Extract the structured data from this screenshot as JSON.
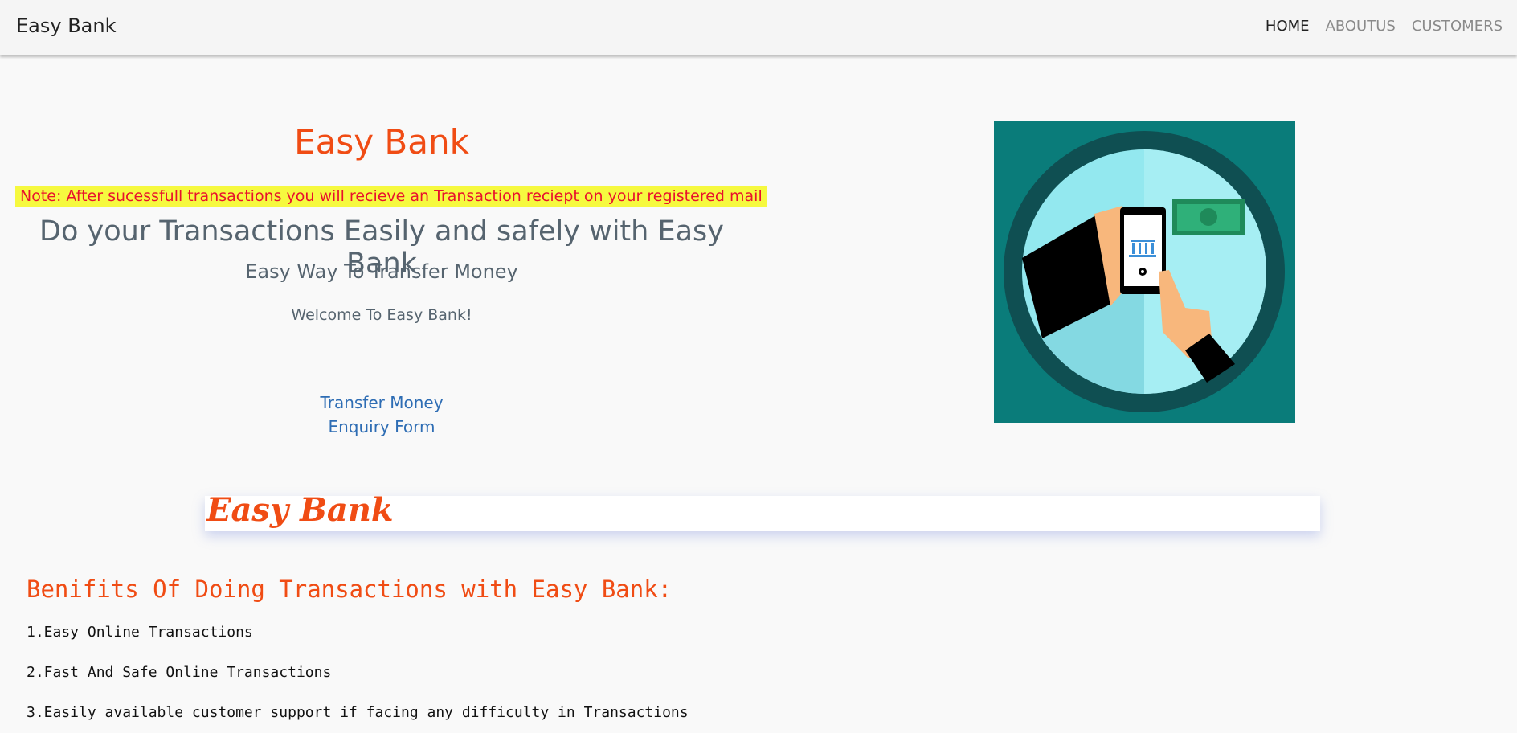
{
  "navbar": {
    "brand": "Easy Bank",
    "links": [
      {
        "label": "HOME",
        "active": true
      },
      {
        "label": "ABOUTUS",
        "active": false
      },
      {
        "label": "CUSTOMERS",
        "active": false
      }
    ]
  },
  "hero": {
    "title": "Easy Bank",
    "note": "Note: After sucessfull transactions you will recieve an Transaction reciept on your registered mail",
    "tagline": "Do your Transactions Easily and safely with Easy Bank",
    "subtitle": "Easy Way To Transfer Money",
    "welcome": "Welcome To Easy Bank!",
    "links": [
      "Transfer Money",
      "Enquiry Form"
    ]
  },
  "banner": {
    "text": "Easy Bank"
  },
  "benefits": {
    "title": "Benifits Of Doing Transactions with Easy Bank:",
    "items": [
      "1.Easy Online Transactions",
      "2.Fast And Safe Online Transactions",
      "3.Easily available customer support if facing any difficulty in Transactions"
    ]
  },
  "colors": {
    "accent": "#f04c14",
    "note_bg": "#f6f93f",
    "note_text": "#e8112d",
    "link": "#2e6db4",
    "illustration_bg": "#0a7c7a"
  },
  "icons": {
    "illustration": "mobile-banking-illustration"
  }
}
